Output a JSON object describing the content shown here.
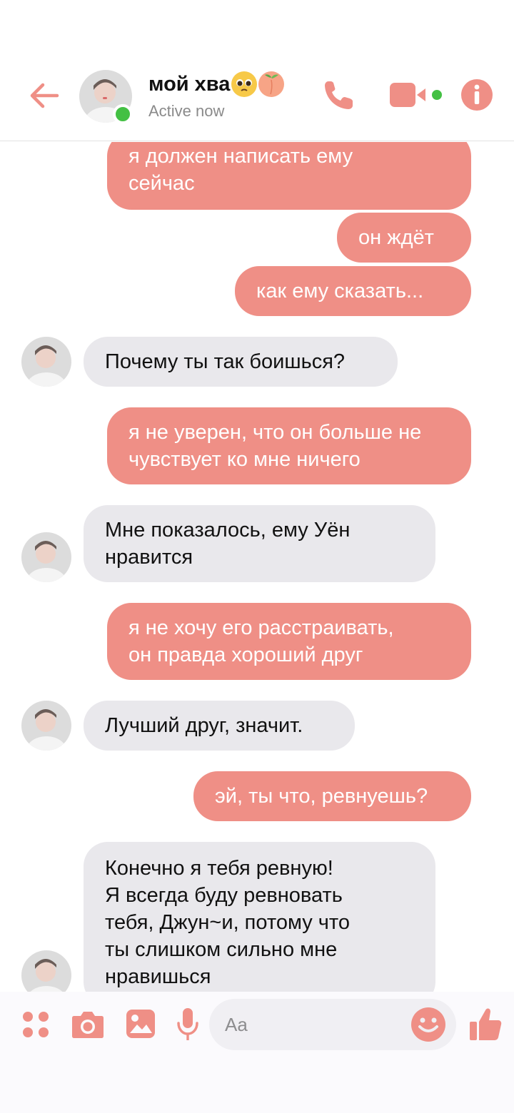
{
  "header": {
    "contact_name": "мой хва",
    "status": "Active now",
    "emojis": [
      "pleading-face",
      "peach"
    ]
  },
  "messages": [
    {
      "from": "me",
      "text": "я должен написать ему\nсейчас"
    },
    {
      "from": "me",
      "text": "он ждёт"
    },
    {
      "from": "me",
      "text": "как ему сказать..."
    },
    {
      "from": "them",
      "text": "Почему ты так боишься?"
    },
    {
      "from": "me",
      "text": "я не уверен, что он больше не\nчувствует ко мне ничего"
    },
    {
      "from": "them",
      "text": "Мне показалось, ему Уён\nнравится"
    },
    {
      "from": "me",
      "text": "я не хочу его расстраивать,\nон правда хороший друг"
    },
    {
      "from": "them",
      "text": "Лучший друг, значит."
    },
    {
      "from": "me",
      "text": "эй, ты что, ревнуешь?"
    },
    {
      "from": "them",
      "text": "Конечно я тебя ревную!\nЯ всегда буду ревновать\nтебя, Джун~и, потому что\nты слишком сильно мне\nнравишься"
    }
  ],
  "composer": {
    "placeholder": "Aa"
  },
  "colors": {
    "accent": "#ef8f86",
    "outgoing_bubble": "#ef8f86",
    "incoming_bubble": "#e9e8ec",
    "online": "#43c043"
  },
  "icons": [
    "back-arrow-icon",
    "phone-icon",
    "video-camera-icon",
    "info-icon",
    "apps-grid-icon",
    "camera-icon",
    "image-icon",
    "microphone-icon",
    "emoji-icon",
    "thumbs-up-icon"
  ]
}
